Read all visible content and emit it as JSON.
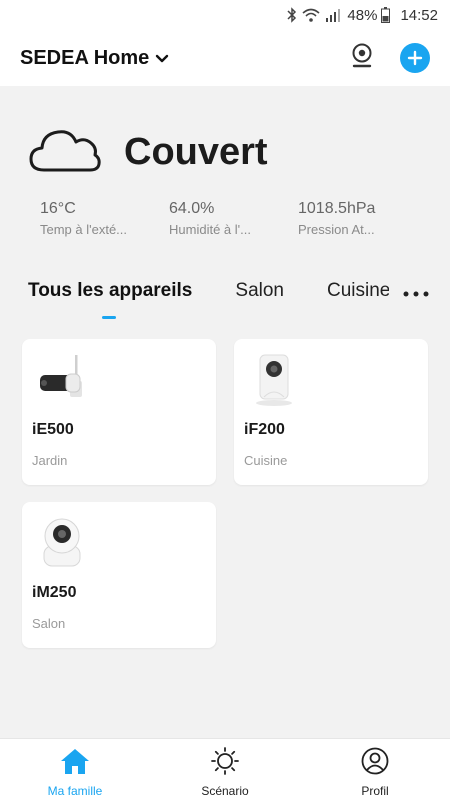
{
  "status_bar": {
    "battery": "48%",
    "time": "14:52",
    "icons": [
      "bluetooth-icon",
      "wifi-icon",
      "signal-icon",
      "battery-icon"
    ]
  },
  "header": {
    "home_name": "SEDEA Home",
    "icons": [
      "chevron-down-icon",
      "camera-icon",
      "add-icon"
    ],
    "accent": "#1aa5f0"
  },
  "weather": {
    "condition": "Couvert",
    "icon": "cloud-icon",
    "stats": [
      {
        "value": "16°C",
        "label": "Temp à l'exté..."
      },
      {
        "value": "64.0%",
        "label": "Humidité à l'..."
      },
      {
        "value": "1018.5hPa",
        "label": "Pression At..."
      }
    ]
  },
  "tabs": {
    "items": [
      "Tous les appareils",
      "Salon",
      "Cuisine"
    ],
    "active": "Tous les appareils"
  },
  "devices": [
    {
      "name": "iE500",
      "room": "Jardin",
      "icon": "bullet-camera-icon"
    },
    {
      "name": "iF200",
      "room": "Cuisine",
      "icon": "indoor-camera-icon"
    },
    {
      "name": "iM250",
      "room": "Salon",
      "icon": "dome-camera-icon"
    }
  ],
  "bottom_nav": {
    "items": [
      {
        "label": "Ma famille",
        "icon": "home-icon",
        "active": true
      },
      {
        "label": "Scénario",
        "icon": "sun-icon",
        "active": false
      },
      {
        "label": "Profil",
        "icon": "profile-icon",
        "active": false
      }
    ]
  }
}
